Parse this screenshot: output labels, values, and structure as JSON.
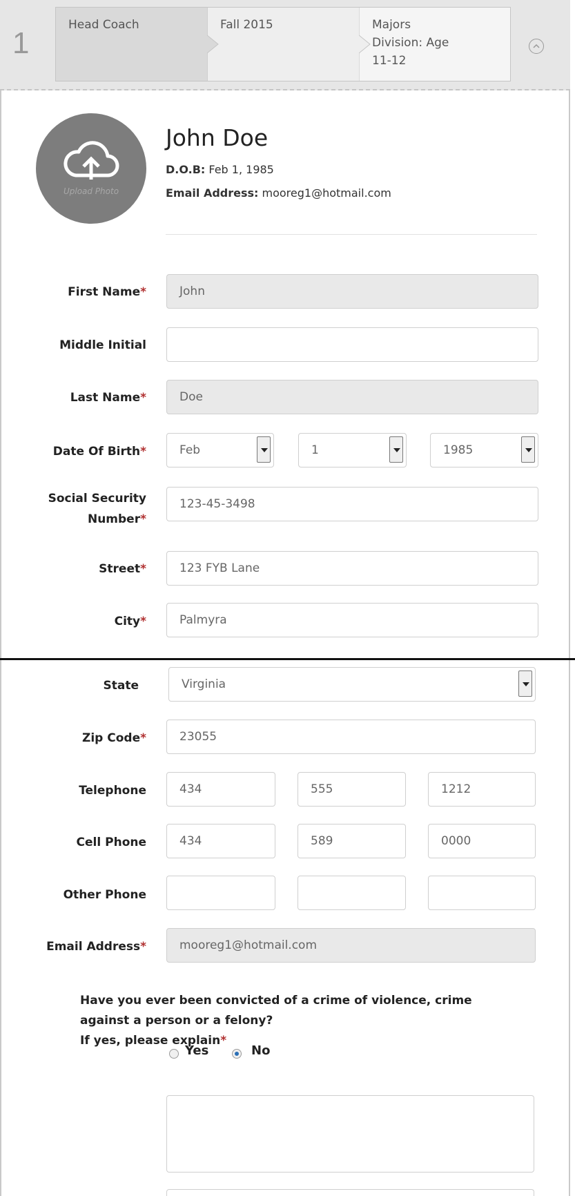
{
  "step": {
    "number": "1",
    "breadcrumbs": [
      "Head Coach",
      "Fall 2015",
      "Majors Division: Age 11-12"
    ],
    "breadcrumb_lines": [
      [
        "Head Coach"
      ],
      [
        "Fall 2015"
      ],
      [
        "Majors",
        "Division: Age",
        "11-12"
      ]
    ],
    "collapse_icon": "chevron-up-circle-icon"
  },
  "profile": {
    "upload_photo_label": "Upload Photo",
    "upload_icon": "cloud-upload-icon",
    "name": "John Doe",
    "dob_label": "D.O.B:",
    "dob_value": "Feb 1, 1985",
    "email_label": "Email Address:",
    "email_value": "mooreg1@hotmail.com"
  },
  "form": {
    "first_name": {
      "label": "First Name",
      "value": "John"
    },
    "middle_initial": {
      "label": "Middle Initial",
      "value": ""
    },
    "last_name": {
      "label": "Last Name",
      "value": "Doe"
    },
    "dob": {
      "label": "Date Of Birth",
      "month": "Feb",
      "day": "1",
      "year": "1985"
    },
    "ssn": {
      "label_line1": "Social Security",
      "label_line2": "Number",
      "value": "123-45-3498"
    },
    "street": {
      "label": "Street",
      "value": "123 FYB Lane"
    },
    "city": {
      "label": "City",
      "value": "Palmyra"
    },
    "state": {
      "label": "State",
      "value": "Virginia"
    },
    "zip": {
      "label": "Zip Code",
      "value": "23055"
    },
    "telephone": {
      "label": "Telephone",
      "area": "434",
      "prefix": "555",
      "line": "1212"
    },
    "cell_phone": {
      "label": "Cell Phone",
      "area": "434",
      "prefix": "589",
      "line": "0000"
    },
    "other_phone": {
      "label": "Other Phone",
      "area": "",
      "prefix": "",
      "line": ""
    },
    "email": {
      "label": "Email Address",
      "value": "mooreg1@hotmail.com"
    },
    "required_marker": "*"
  },
  "question": {
    "line1": "Have you ever been convicted of a crime of violence, crime",
    "line2": "against a person or a felony?",
    "line3": "If yes, please explain",
    "yes_label": "Yes",
    "no_label": "No",
    "selected": "No",
    "explanation": ""
  },
  "colors": {
    "header_bg": "#e6e6e6",
    "required": "#b03030",
    "readonly_field": "#e9e9e9",
    "radio_selected": "#2a6fb5"
  }
}
